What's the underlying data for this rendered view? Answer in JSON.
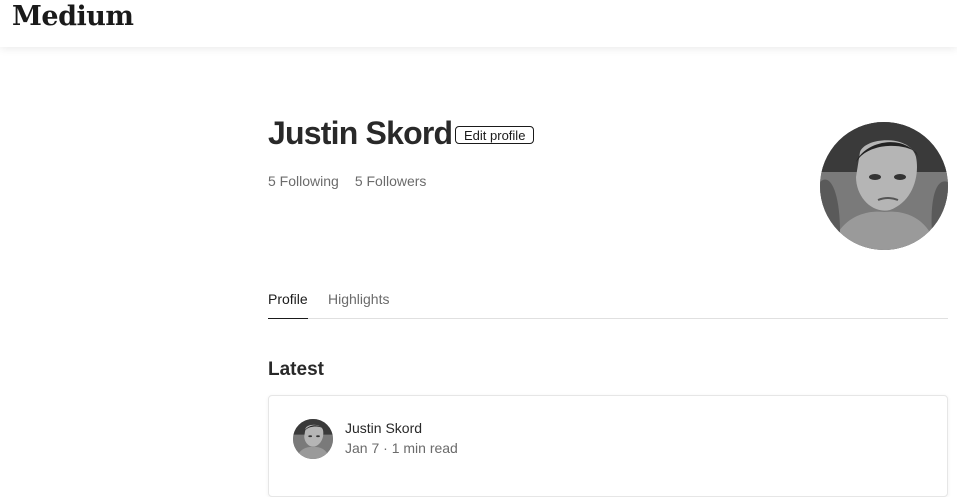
{
  "header": {
    "logo": "Medium"
  },
  "profile": {
    "name": "Justin Skord",
    "edit_label": "Edit profile",
    "following": "5 Following",
    "followers": "5 Followers"
  },
  "tabs": [
    {
      "label": "Profile",
      "active": true
    },
    {
      "label": "Highlights",
      "active": false
    }
  ],
  "latest": {
    "title": "Latest",
    "posts": [
      {
        "author": "Justin Skord",
        "meta": "Jan 7 · 1 min read"
      }
    ]
  }
}
